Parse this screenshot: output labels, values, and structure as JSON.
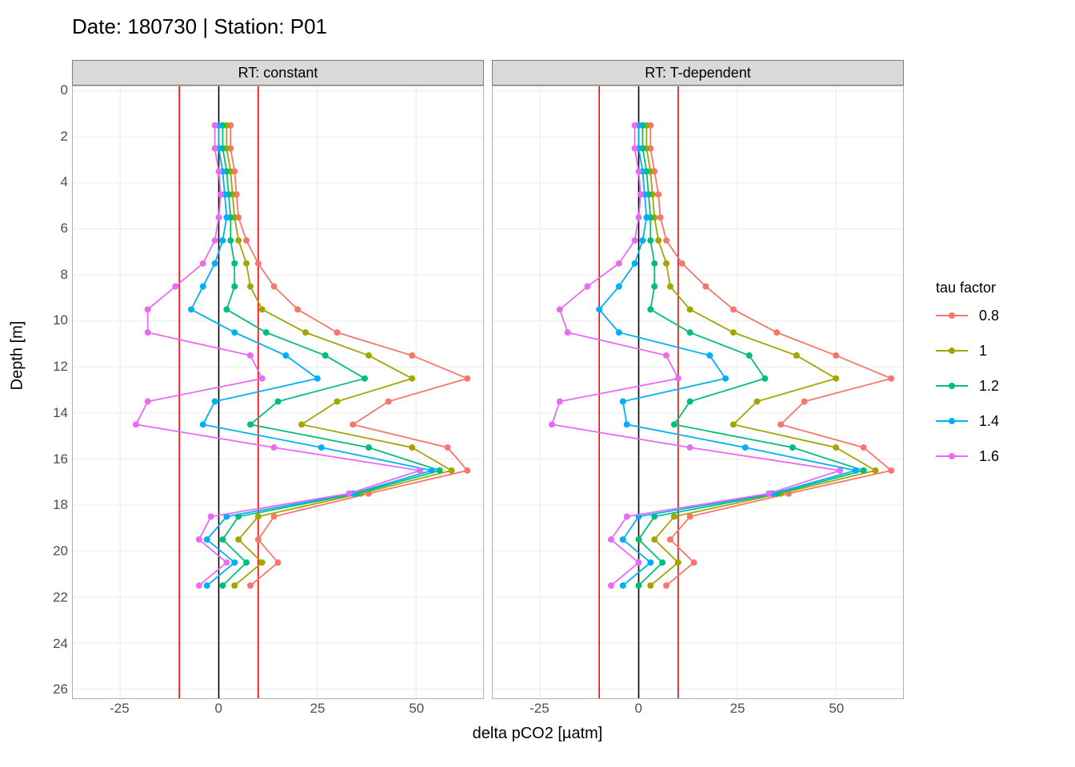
{
  "title": "Date: 180730 | Station: P01",
  "ylabel": "Depth [m]",
  "xlabel": "delta pCO2 [µatm]",
  "legend": {
    "title": "tau factor",
    "items": [
      {
        "label": "0.8",
        "color": "#F8766D"
      },
      {
        "label": "1",
        "color": "#A3A500"
      },
      {
        "label": "1.2",
        "color": "#00BF7D"
      },
      {
        "label": "1.4",
        "color": "#00B0F6"
      },
      {
        "label": "1.6",
        "color": "#E76BF3"
      }
    ]
  },
  "facets": [
    {
      "key": "constant",
      "strip": "RT: constant"
    },
    {
      "key": "tdependent",
      "strip": "RT: T-dependent"
    }
  ],
  "chart_data": {
    "type": "line",
    "xlabel": "delta pCO2 [µatm]",
    "ylabel": "Depth [m]",
    "xlim": [
      -37,
      67
    ],
    "ylim": [
      -0.2,
      26.4
    ],
    "y_reversed": true,
    "x_ticks": [
      -25,
      0,
      25,
      50
    ],
    "y_ticks": [
      0,
      2,
      4,
      6,
      8,
      10,
      12,
      14,
      16,
      18,
      20,
      22,
      24,
      26
    ],
    "vlines": [
      {
        "x": 0,
        "color": "#000000"
      },
      {
        "x": -10,
        "color": "#FF0000"
      },
      {
        "x": 10,
        "color": "#FF0000"
      }
    ],
    "depths": [
      1.5,
      2.5,
      3.5,
      4.5,
      5.5,
      6.5,
      7.5,
      8.5,
      9.5,
      10.5,
      11.5,
      12.5,
      13.5,
      14.5,
      15.5,
      16.5,
      17.5,
      18.5,
      19.5,
      20.5,
      21.5
    ],
    "panels": {
      "constant": {
        "series": [
          {
            "name": "0.8",
            "color": "#F8766D",
            "x": [
              3,
              3,
              4,
              4.5,
              5,
              7,
              10,
              14,
              20,
              30,
              49,
              63,
              43,
              34,
              58,
              63,
              38,
              14,
              10,
              15,
              8
            ]
          },
          {
            "name": "1",
            "color": "#A3A500",
            "x": [
              2,
              2,
              3,
              3.5,
              4,
              5,
              7,
              8,
              11,
              22,
              38,
              49,
              30,
              21,
              49,
              59,
              36,
              10,
              5,
              11,
              4
            ]
          },
          {
            "name": "1.2",
            "color": "#00BF7D",
            "x": [
              1,
              1,
              2,
              2.5,
              3,
              3,
              4,
              4,
              2,
              12,
              27,
              37,
              15,
              8,
              38,
              56,
              35,
              5,
              1,
              7,
              1
            ]
          },
          {
            "name": "1.4",
            "color": "#00B0F6",
            "x": [
              0,
              0,
              1,
              1.5,
              2,
              1,
              -1,
              -4,
              -7,
              4,
              17,
              25,
              -1,
              -4,
              26,
              54,
              34,
              2,
              -3,
              4,
              -3
            ]
          },
          {
            "name": "1.6",
            "color": "#E76BF3",
            "x": [
              -1,
              -1,
              0,
              0.5,
              0,
              -1,
              -4,
              -11,
              -18,
              -18,
              8,
              11,
              -18,
              -21,
              14,
              51,
              33,
              -2,
              -5,
              2,
              -5
            ]
          }
        ]
      },
      "tdependent": {
        "series": [
          {
            "name": "0.8",
            "color": "#F8766D",
            "x": [
              3,
              3,
              4,
              5,
              5.5,
              7,
              11,
              17,
              24,
              35,
              50,
              64,
              42,
              36,
              57,
              64,
              38,
              13,
              8,
              14,
              7
            ]
          },
          {
            "name": "1",
            "color": "#A3A500",
            "x": [
              2,
              2,
              3,
              3.5,
              4,
              5,
              7,
              8,
              13,
              24,
              40,
              50,
              30,
              24,
              50,
              60,
              36,
              9,
              4,
              10,
              3
            ]
          },
          {
            "name": "1.2",
            "color": "#00BF7D",
            "x": [
              1,
              1,
              2,
              2.5,
              3,
              3,
              4,
              4,
              3,
              13,
              28,
              32,
              13,
              9,
              39,
              57,
              35,
              4,
              0,
              6,
              0
            ]
          },
          {
            "name": "1.4",
            "color": "#00B0F6",
            "x": [
              0,
              0,
              1,
              1.5,
              2,
              1,
              -1,
              -5,
              -10,
              -5,
              18,
              22,
              -4,
              -3,
              27,
              55,
              34,
              0,
              -4,
              3,
              -4
            ]
          },
          {
            "name": "1.6",
            "color": "#E76BF3",
            "x": [
              -1,
              -1,
              0,
              0.5,
              0,
              -1,
              -5,
              -13,
              -20,
              -18,
              7,
              10,
              -20,
              -22,
              13,
              51,
              33,
              -3,
              -7,
              0,
              -7
            ]
          }
        ]
      }
    }
  }
}
